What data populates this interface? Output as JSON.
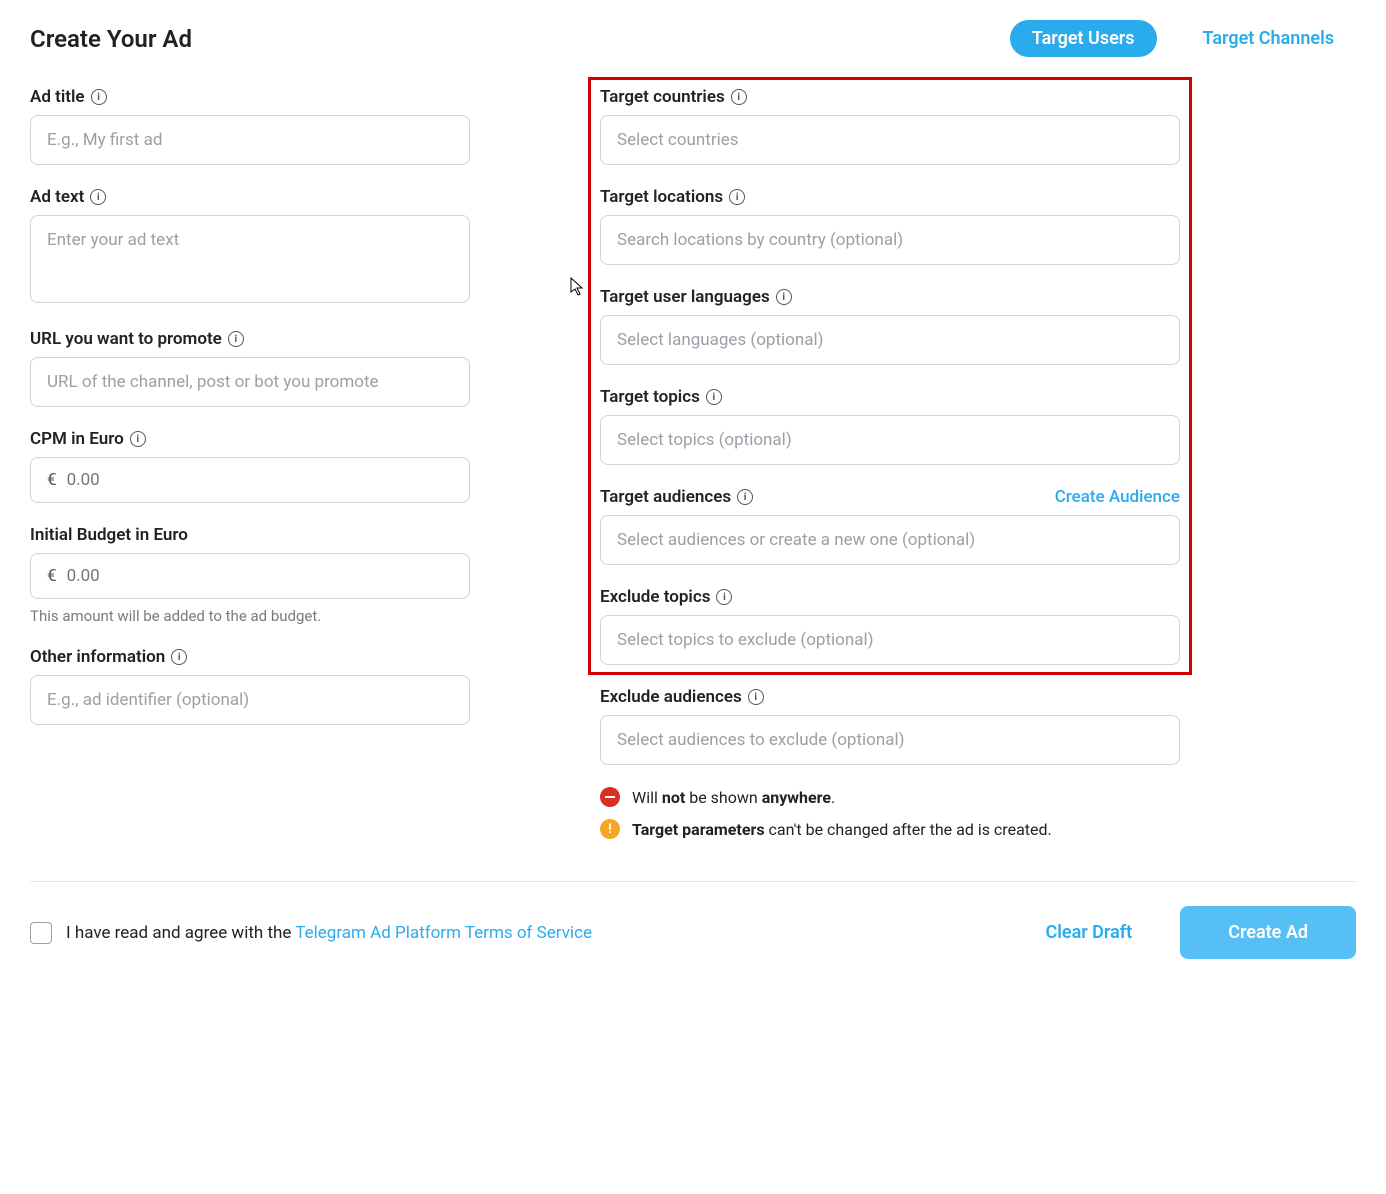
{
  "header": {
    "title": "Create Your Ad",
    "tab_users": "Target Users",
    "tab_channels": "Target Channels"
  },
  "left": {
    "ad_title_label": "Ad title",
    "ad_title_placeholder": "E.g., My first ad",
    "ad_text_label": "Ad text",
    "ad_text_placeholder": "Enter your ad text",
    "url_label": "URL you want to promote",
    "url_placeholder": "URL of the channel, post or bot you promote",
    "cpm_label": "CPM in Euro",
    "cpm_currency": "€",
    "cpm_value": "0.00",
    "budget_label": "Initial Budget in Euro",
    "budget_currency": "€",
    "budget_value": "0.00",
    "budget_hint": "This amount will be added to the ad budget.",
    "other_label": "Other information",
    "other_placeholder": "E.g., ad identifier (optional)"
  },
  "right": {
    "countries_label": "Target countries",
    "countries_placeholder": "Select countries",
    "locations_label": "Target locations",
    "locations_placeholder": "Search locations by country (optional)",
    "languages_label": "Target user languages",
    "languages_placeholder": "Select languages (optional)",
    "topics_label": "Target topics",
    "topics_placeholder": "Select topics (optional)",
    "audiences_label": "Target audiences",
    "audiences_create": "Create Audience",
    "audiences_placeholder": "Select audiences or create a new one (optional)",
    "exclude_topics_label": "Exclude topics",
    "exclude_topics_placeholder": "Select topics to exclude (optional)",
    "exclude_audiences_label": "Exclude audiences",
    "exclude_audiences_placeholder": "Select audiences to exclude (optional)"
  },
  "notes": {
    "n1_pre": "Will ",
    "n1_bold1": "not",
    "n1_mid": " be shown ",
    "n1_bold2": "anywhere",
    "n1_post": ".",
    "n2_bold": "Target parameters",
    "n2_rest": " can't be changed after the ad is created."
  },
  "footer": {
    "terms_pre": "I have read and agree with the ",
    "terms_link": "Telegram Ad Platform Terms of Service",
    "clear_draft": "Clear Draft",
    "create_ad": "Create Ad"
  }
}
